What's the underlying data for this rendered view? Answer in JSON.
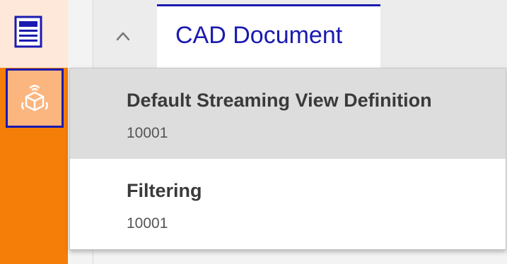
{
  "colors": {
    "brand_blue": "#1a1ab0",
    "rail_orange": "#f57e08",
    "rail_peach": "#fde8d9",
    "selected_option": "#dddddd"
  },
  "rail": {
    "items": [
      {
        "icon": "document-list-icon"
      },
      {
        "icon": "streaming-cube-icon",
        "selected": true
      }
    ]
  },
  "tabbar": {
    "collapse_icon": "chevron-up-icon",
    "active_tab": "CAD Document"
  },
  "dropdown": {
    "options": [
      {
        "title": "Default Streaming View Definition",
        "subtitle": "10001",
        "highlighted": true
      },
      {
        "title": "Filtering",
        "subtitle": "10001"
      }
    ]
  }
}
